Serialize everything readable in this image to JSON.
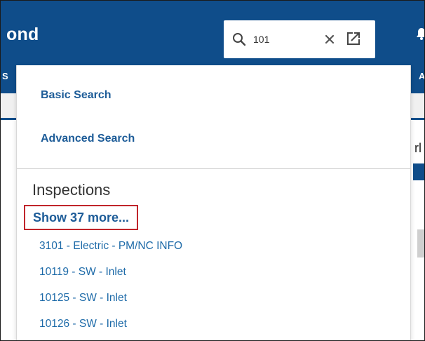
{
  "header": {
    "brand": "ond",
    "colors": {
      "primary": "#0f4d8a",
      "link": "#1d5c98",
      "highlight": "#c0252b"
    },
    "icons": {
      "notifications": "bell-icon"
    }
  },
  "search": {
    "value": "101",
    "icons": {
      "search": "search-icon",
      "clear": "close-icon",
      "open": "external-link-icon"
    }
  },
  "background": {
    "subnav_left": "S",
    "subnav_right": "A",
    "right_text": "rl"
  },
  "dropdown": {
    "basic_search": "Basic Search",
    "advanced_search": "Advanced Search",
    "section_title": "Inspections",
    "show_more": "Show 37 more...",
    "results": [
      "3101 - Electric - PM/NC INFO",
      "10119 - SW - Inlet",
      "10125 - SW - Inlet",
      "10126 - SW - Inlet"
    ]
  }
}
